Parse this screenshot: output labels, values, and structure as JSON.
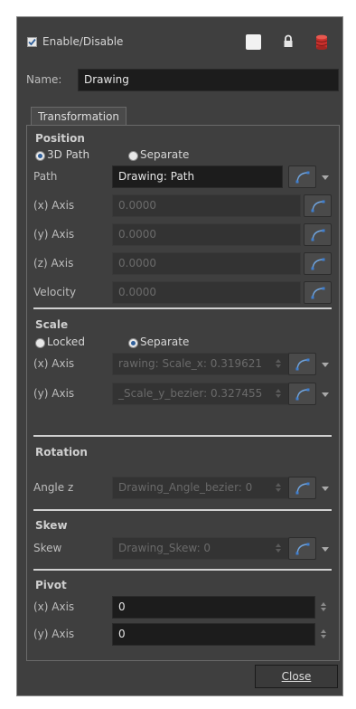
{
  "header": {
    "enable_label": "Enable/Disable",
    "enabled": true
  },
  "name": {
    "label": "Name:",
    "value": "Drawing"
  },
  "tabs": [
    {
      "label": "Transformation"
    }
  ],
  "position": {
    "title": "Position",
    "mode_3d": "3D Path",
    "mode_separate": "Separate",
    "selected_mode": "3D Path",
    "path_label": "Path",
    "path_value": "Drawing: Path",
    "x_label": "(x) Axis",
    "x_value": "0.0000",
    "y_label": "(y) Axis",
    "y_value": "0.0000",
    "z_label": "(z) Axis",
    "z_value": "0.0000",
    "velocity_label": "Velocity",
    "velocity_value": "0.0000"
  },
  "scale": {
    "title": "Scale",
    "mode_locked": "Locked",
    "mode_separate": "Separate",
    "selected_mode": "Separate",
    "x_label": "(x) Axis",
    "x_value": "rawing: Scale_x: 0.319621",
    "y_label": "(y) Axis",
    "y_value": "_Scale_y_bezier: 0.327455"
  },
  "rotation": {
    "title": "Rotation",
    "angle_label": "Angle z",
    "angle_value": "Drawing_Angle_bezier: 0"
  },
  "skew": {
    "title": "Skew",
    "skew_label": "Skew",
    "skew_value": "Drawing_Skew: 0"
  },
  "pivot": {
    "title": "Pivot",
    "x_label": "(x) Axis",
    "x_value": "0",
    "y_label": "(y) Axis",
    "y_value": "0"
  },
  "footer": {
    "close_label": "Close"
  },
  "colors": {
    "panel_bg": "#3f3f3f",
    "field_bg": "#1c1c1c",
    "accent": "#2f5f9a",
    "function_icon": "#3f7fd0"
  },
  "icons": [
    "checkmark-icon",
    "white-square-icon",
    "lock-icon",
    "database-icon",
    "function-curve-icon",
    "dropdown-arrow-icon",
    "spinner-arrows-icon"
  ]
}
